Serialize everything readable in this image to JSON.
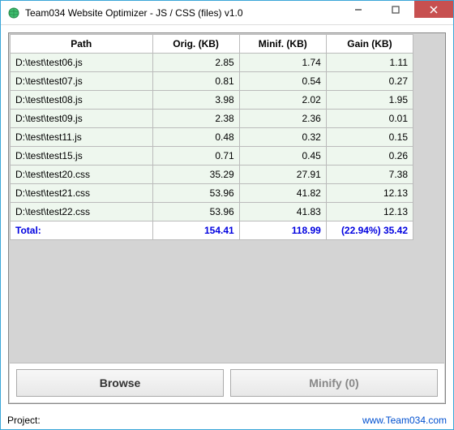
{
  "window": {
    "title": "Team034 Website Optimizer - JS / CSS (files) v1.0"
  },
  "grid": {
    "headers": {
      "path": "Path",
      "orig": "Orig. (KB)",
      "minif": "Minif. (KB)",
      "gain": "Gain (KB)"
    },
    "rows": [
      {
        "path": "D:\\test\\test06.js",
        "orig": "2.85",
        "minif": "1.74",
        "gain": "1.11"
      },
      {
        "path": "D:\\test\\test07.js",
        "orig": "0.81",
        "minif": "0.54",
        "gain": "0.27"
      },
      {
        "path": "D:\\test\\test08.js",
        "orig": "3.98",
        "minif": "2.02",
        "gain": "1.95"
      },
      {
        "path": "D:\\test\\test09.js",
        "orig": "2.38",
        "minif": "2.36",
        "gain": "0.01"
      },
      {
        "path": "D:\\test\\test11.js",
        "orig": "0.48",
        "minif": "0.32",
        "gain": "0.15"
      },
      {
        "path": "D:\\test\\test15.js",
        "orig": "0.71",
        "minif": "0.45",
        "gain": "0.26"
      },
      {
        "path": "D:\\test\\test20.css",
        "orig": "35.29",
        "minif": "27.91",
        "gain": "7.38"
      },
      {
        "path": "D:\\test\\test21.css",
        "orig": "53.96",
        "minif": "41.82",
        "gain": "12.13"
      },
      {
        "path": "D:\\test\\test22.css",
        "orig": "53.96",
        "minif": "41.83",
        "gain": "12.13"
      }
    ],
    "total": {
      "label": "Total:",
      "orig": "154.41",
      "minif": "118.99",
      "gain": "(22.94%) 35.42"
    }
  },
  "buttons": {
    "browse": "Browse",
    "minify": "Minify (0)"
  },
  "status": {
    "project_label": "Project:",
    "link": "www.Team034.com"
  }
}
